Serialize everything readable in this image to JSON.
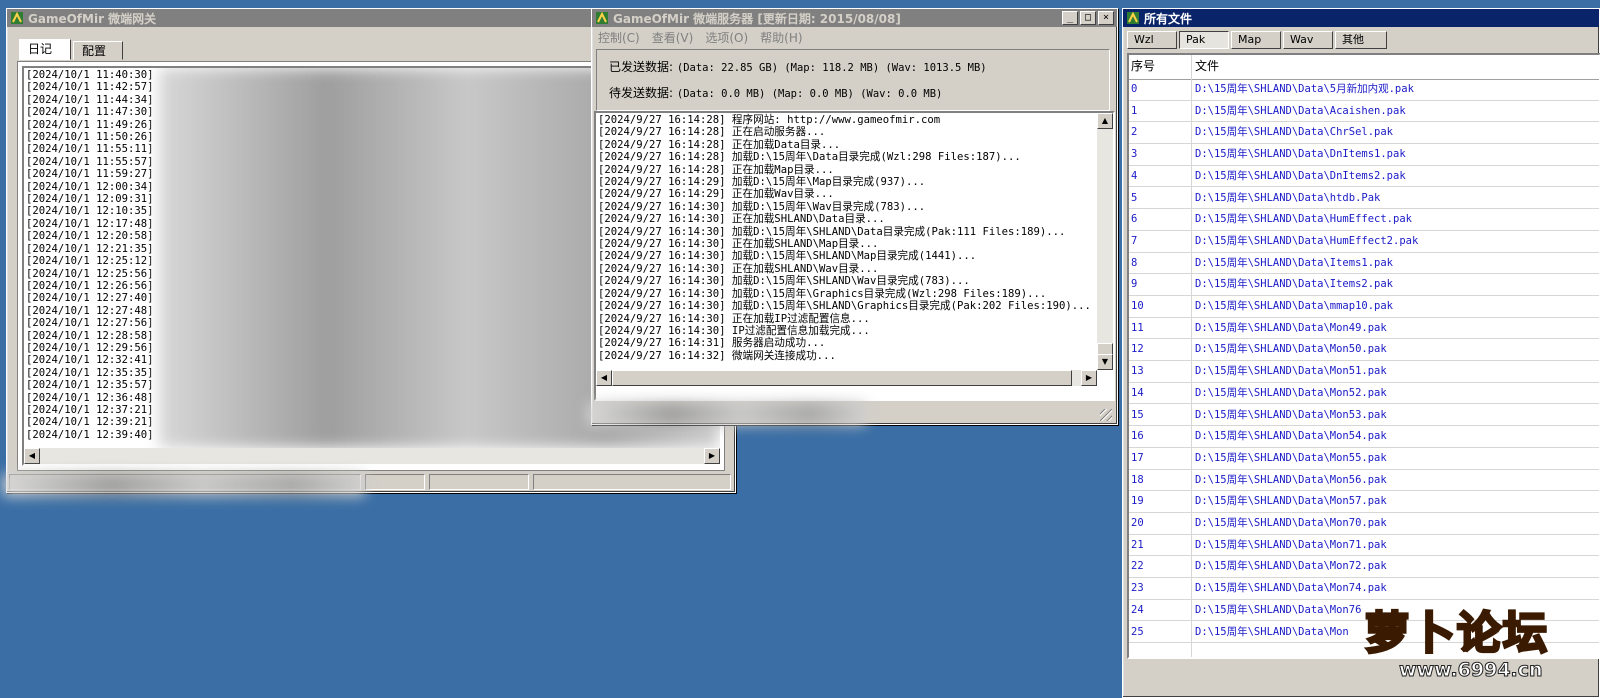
{
  "gateway_window": {
    "title": "GameOfMir 微端网关",
    "tabs": [
      "日记",
      "配置"
    ],
    "log": [
      "[2024/10/1 11:40:30]",
      "[2024/10/1 11:42:57]",
      "[2024/10/1 11:44:34]",
      "[2024/10/1 11:47:30]",
      "[2024/10/1 11:49:26]",
      "[2024/10/1 11:50:26]",
      "[2024/10/1 11:55:11]",
      "[2024/10/1 11:55:57]",
      "[2024/10/1 11:59:27]",
      "[2024/10/1 12:00:34]",
      "[2024/10/1 12:09:31]",
      "[2024/10/1 12:10:35]",
      "[2024/10/1 12:17:48]",
      "[2024/10/1 12:20:58]",
      "[2024/10/1 12:21:35]",
      "[2024/10/1 12:25:12]",
      "[2024/10/1 12:25:56]",
      "[2024/10/1 12:26:56]",
      "[2024/10/1 12:27:40]",
      "[2024/10/1 12:27:48]",
      "[2024/10/1 12:27:56]",
      "[2024/10/1 12:28:58]",
      "[2024/10/1 12:29:56]",
      "[2024/10/1 12:32:41]",
      "[2024/10/1 12:35:35]",
      "[2024/10/1 12:35:57]",
      "[2024/10/1 12:36:48]",
      "[2024/10/1 12:37:21]",
      "[2024/10/1 12:39:21]",
      "[2024/10/1 12:39:40]"
    ]
  },
  "server_window": {
    "title": "GameOfMir 微端服务器 [更新日期: 2015/08/08]",
    "menu": [
      "控制(C)",
      "查看(V)",
      "选项(O)",
      "帮助(H)"
    ],
    "sent_label": "已发送数据:",
    "sent_value": "(Data: 22.85 GB) (Map: 118.2 MB) (Wav: 1013.5 MB)",
    "pending_label": "待发送数据:",
    "pending_value": "(Data: 0.0 MB) (Map: 0.0 MB) (Wav: 0.0 MB)",
    "log": [
      "[2024/9/27 16:14:28] 程序网站: http://www.gameofmir.com",
      "[2024/9/27 16:14:28] 正在启动服务器...",
      "[2024/9/27 16:14:28] 正在加载Data目录...",
      "[2024/9/27 16:14:28] 加载D:\\15周年\\Data目录完成(Wzl:298 Files:187)...",
      "[2024/9/27 16:14:28] 正在加载Map目录...",
      "[2024/9/27 16:14:29] 加载D:\\15周年\\Map目录完成(937)...",
      "[2024/9/27 16:14:29] 正在加载Wav目录...",
      "[2024/9/27 16:14:30] 加载D:\\15周年\\Wav目录完成(783)...",
      "[2024/9/27 16:14:30] 正在加载SHLAND\\Data目录...",
      "[2024/9/27 16:14:30] 加载D:\\15周年\\SHLAND\\Data目录完成(Pak:111 Files:189)...",
      "[2024/9/27 16:14:30] 正在加载SHLAND\\Map目录...",
      "[2024/9/27 16:14:30] 加载D:\\15周年\\SHLAND\\Map目录完成(1441)...",
      "[2024/9/27 16:14:30] 正在加载SHLAND\\Wav目录...",
      "[2024/9/27 16:14:30] 加载D:\\15周年\\SHLAND\\Wav目录完成(783)...",
      "[2024/9/27 16:14:30] 加载D:\\15周年\\Graphics目录完成(Wzl:298 Files:189)...",
      "[2024/9/27 16:14:30] 加载D:\\15周年\\SHLAND\\Graphics目录完成(Pak:202 Files:190)...",
      "[2024/9/27 16:14:30] 正在加载IP过滤配置信息...",
      "[2024/9/27 16:14:30] IP过滤配置信息加载完成...",
      "[2024/9/27 16:14:31] 服务器启动成功...",
      "[2024/9/27 16:14:32] 微端网关连接成功..."
    ]
  },
  "files_window": {
    "title": "所有文件",
    "tabs": [
      "Wzl",
      "Pak",
      "Map",
      "Wav",
      "其他"
    ],
    "selected_tab": "Pak",
    "columns": [
      "序号",
      "文件"
    ],
    "rows": [
      [
        "0",
        "D:\\15周年\\SHLAND\\Data\\5月新加内观.pak"
      ],
      [
        "1",
        "D:\\15周年\\SHLAND\\Data\\Acaishen.pak"
      ],
      [
        "2",
        "D:\\15周年\\SHLAND\\Data\\ChrSel.pak"
      ],
      [
        "3",
        "D:\\15周年\\SHLAND\\Data\\DnItems1.pak"
      ],
      [
        "4",
        "D:\\15周年\\SHLAND\\Data\\DnItems2.pak"
      ],
      [
        "5",
        "D:\\15周年\\SHLAND\\Data\\htdb.Pak"
      ],
      [
        "6",
        "D:\\15周年\\SHLAND\\Data\\HumEffect.pak"
      ],
      [
        "7",
        "D:\\15周年\\SHLAND\\Data\\HumEffect2.pak"
      ],
      [
        "8",
        "D:\\15周年\\SHLAND\\Data\\Items1.pak"
      ],
      [
        "9",
        "D:\\15周年\\SHLAND\\Data\\Items2.pak"
      ],
      [
        "10",
        "D:\\15周年\\SHLAND\\Data\\mmap10.pak"
      ],
      [
        "11",
        "D:\\15周年\\SHLAND\\Data\\Mon49.pak"
      ],
      [
        "12",
        "D:\\15周年\\SHLAND\\Data\\Mon50.pak"
      ],
      [
        "13",
        "D:\\15周年\\SHLAND\\Data\\Mon51.pak"
      ],
      [
        "14",
        "D:\\15周年\\SHLAND\\Data\\Mon52.pak"
      ],
      [
        "15",
        "D:\\15周年\\SHLAND\\Data\\Mon53.pak"
      ],
      [
        "16",
        "D:\\15周年\\SHLAND\\Data\\Mon54.pak"
      ],
      [
        "17",
        "D:\\15周年\\SHLAND\\Data\\Mon55.pak"
      ],
      [
        "18",
        "D:\\15周年\\SHLAND\\Data\\Mon56.pak"
      ],
      [
        "19",
        "D:\\15周年\\SHLAND\\Data\\Mon57.pak"
      ],
      [
        "20",
        "D:\\15周年\\SHLAND\\Data\\Mon70.pak"
      ],
      [
        "21",
        "D:\\15周年\\SHLAND\\Data\\Mon71.pak"
      ],
      [
        "22",
        "D:\\15周年\\SHLAND\\Data\\Mon72.pak"
      ],
      [
        "23",
        "D:\\15周年\\SHLAND\\Data\\Mon74.pak"
      ],
      [
        "24",
        "D:\\15周年\\SHLAND\\Data\\Mon76"
      ],
      [
        "25",
        "D:\\15周年\\SHLAND\\Data\\Mon"
      ]
    ]
  },
  "watermark": {
    "brand": "萝卜论坛",
    "url": "www.6994.cn"
  },
  "colors": {
    "desktop": "#3a6ea5",
    "active_title": "#0a246a",
    "inactive_title": "#808080",
    "file_text": "#1a1ac8"
  }
}
